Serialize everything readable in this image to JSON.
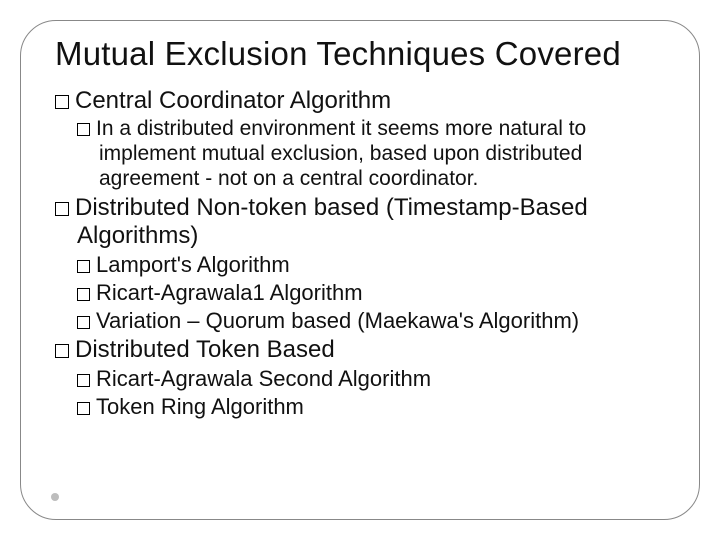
{
  "title": "Mutual Exclusion Techniques Covered",
  "items": {
    "central": "Central Coordinator Algorithm",
    "central_note": "In a distributed environment it seems more natural to implement mutual exclusion, based upon distributed agreement - not on a central coordinator.",
    "dist_nontoken": "Distributed Non-token based (Timestamp-Based Algorithms)",
    "lamport": "Lamport's Algorithm",
    "ricart1": "Ricart-Agrawala1 Algorithm",
    "variation": "Variation – Quorum based (Maekawa's Algorithm)",
    "dist_token": "Distributed Token Based",
    "ricart2": "Ricart-Agrawala Second Algorithm",
    "tokenring": "Token Ring Algorithm"
  }
}
